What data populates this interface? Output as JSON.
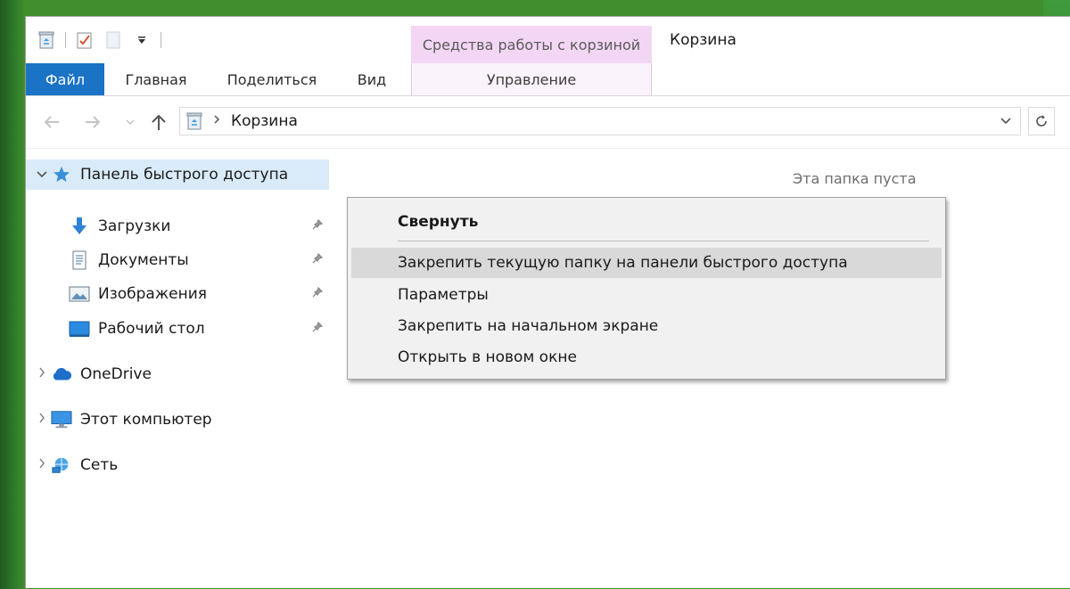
{
  "window": {
    "title": "Корзина",
    "context_group": "Средства работы с корзиной"
  },
  "ribbon": {
    "tabs": [
      {
        "label": "Файл"
      },
      {
        "label": "Главная"
      },
      {
        "label": "Поделиться"
      },
      {
        "label": "Вид"
      },
      {
        "label": "Управление"
      }
    ]
  },
  "address": {
    "path": "Корзина"
  },
  "nav_pane": {
    "quick_access": "Панель быстрого доступа",
    "quick_items": [
      {
        "label": "Загрузки",
        "icon": "download-icon"
      },
      {
        "label": "Документы",
        "icon": "documents-icon"
      },
      {
        "label": "Изображения",
        "icon": "pictures-icon"
      },
      {
        "label": "Рабочий стол",
        "icon": "desktop-icon"
      }
    ],
    "onedrive": "OneDrive",
    "this_pc": "Этот компьютер",
    "network": "Сеть"
  },
  "content": {
    "empty_text": "Эта папка пуста"
  },
  "context_menu": {
    "items": [
      {
        "label": "Свернуть"
      },
      {
        "label": "Закрепить текущую папку на панели быстрого доступа"
      },
      {
        "label": "Параметры"
      },
      {
        "label": "Закрепить на начальном экране"
      },
      {
        "label": "Открыть в новом окне"
      }
    ]
  },
  "colors": {
    "file_tab": "#1a73c4",
    "context_group": "#f3d6f3",
    "selection": "#d9ebf9",
    "menu_highlight": "#d9d9d9"
  }
}
